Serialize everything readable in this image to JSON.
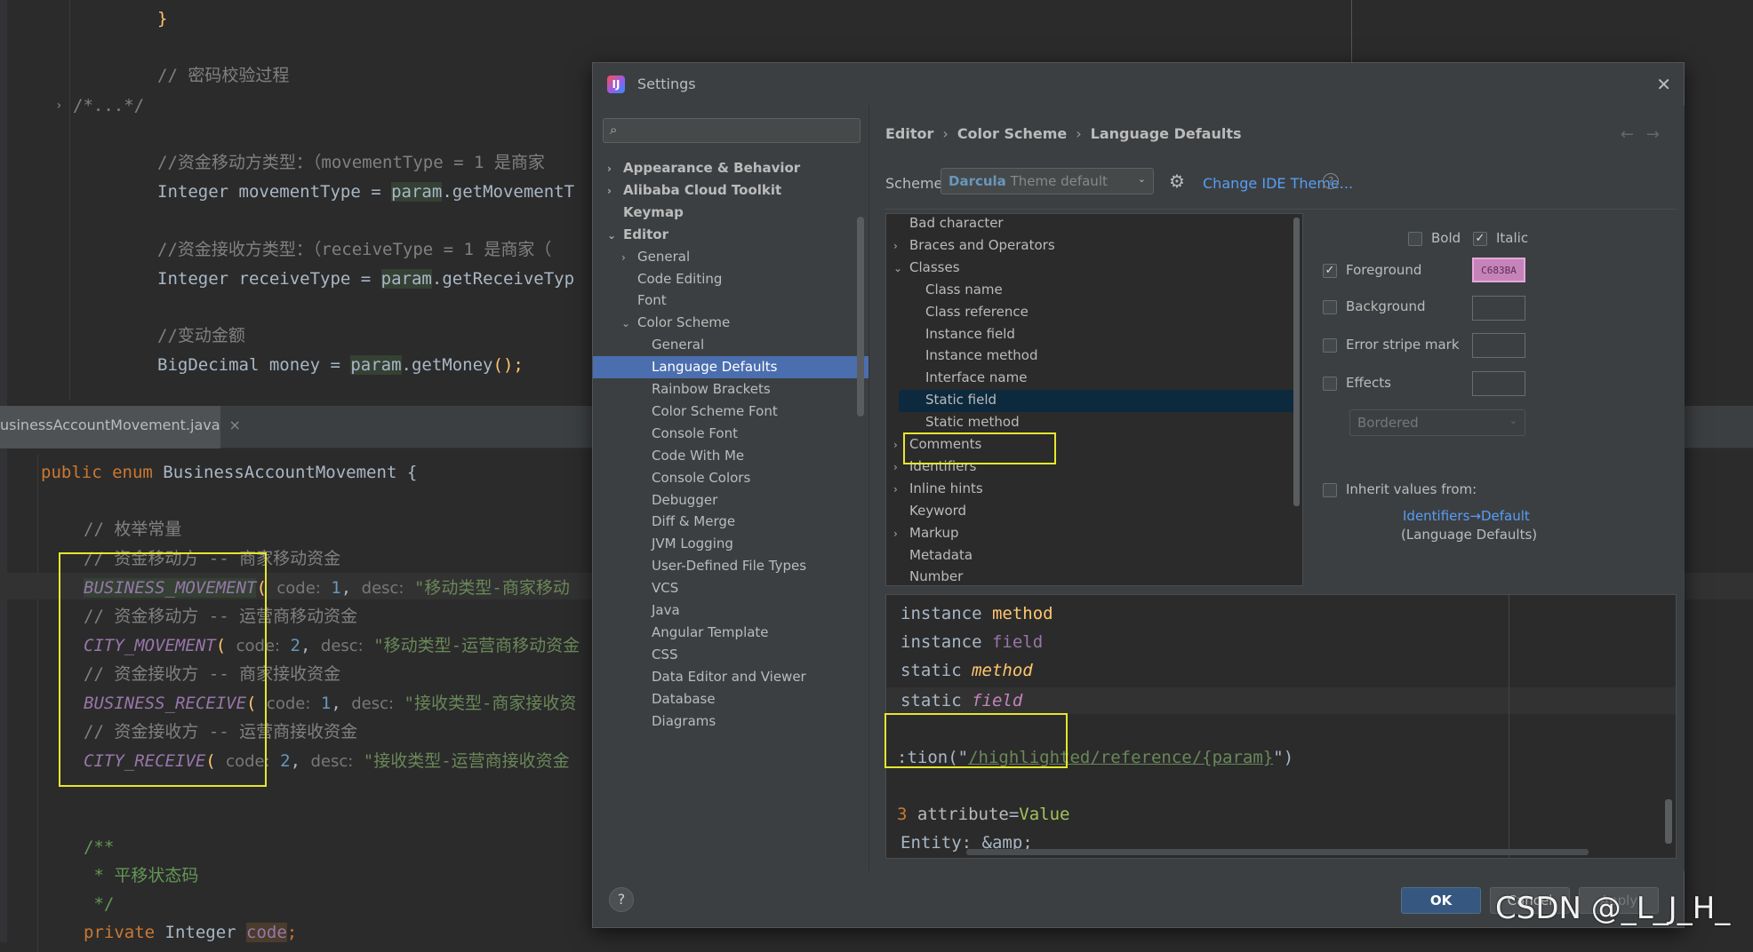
{
  "editor_top": {
    "line_brace": "}",
    "comment_verify": "// 密码校验过程",
    "folded": "/*...*/",
    "comment_movement_type": "//资金移动方类型：（movementType = 1 是商家",
    "movement_line_a": "Integer movementType = ",
    "movement_line_b": "param",
    "movement_line_c": ".getMovementT",
    "comment_receive_type": "//资金接收方类型：（receiveType = 1 是商家（",
    "receive_line_a": "Integer receiveType = ",
    "receive_line_b": "param",
    "receive_line_c": ".getReceiveTyp",
    "comment_amount": "//变动金额",
    "money_line_a": "BigDecimal money = ",
    "money_line_b": "param",
    "money_line_c": ".getMoney",
    "money_line_d": "();"
  },
  "tab": {
    "filename": "usinessAccountMovement.java",
    "close": "×"
  },
  "editor_bottom": {
    "enum_kw": "public enum ",
    "enum_name": "BusinessAccountMovement {",
    "comment_enum": "// 枚举常量",
    "c1": "// 资金移动方 -- 商家移动资金",
    "e1": "BUSINESS_MOVEMENT",
    "e1_rest_a": "code:",
    "e1_num": "1",
    "e1_rest_b": "desc:",
    "e1_str": "\"移动类型-商家移动",
    "c2": "// 资金移动方 -- 运营商移动资金",
    "e2": "CITY_MOVEMENT",
    "e2_num": "2",
    "e2_str": "\"移动类型-运营商移动资金",
    "c3": "// 资金接收方 -- 商家接收资金",
    "e3": "BUSINESS_RECEIVE",
    "e3_num": "1",
    "e3_str": "\"接收类型-商家接收资",
    "c4": "// 资金接收方 -- 运营商接收资金",
    "e4": "CITY_RECEIVE",
    "e4_num": "2",
    "e4_str": "\"接收类型-运营商接收资金",
    "doc1": "/**",
    "doc2": " * 平移状态码",
    "doc3": " */",
    "priv": "private ",
    "priv_type": "Integer ",
    "priv_field": "code",
    "priv_end": ";"
  },
  "dialog": {
    "title": "Settings",
    "logo": "IJ",
    "close": "✕",
    "search_icon": "⌕",
    "nav": [
      {
        "label": "Appearance & Behavior",
        "arrow": "›",
        "bold": true,
        "indent": 0
      },
      {
        "label": "Alibaba Cloud Toolkit",
        "arrow": "›",
        "bold": true,
        "indent": 0
      },
      {
        "label": "Keymap",
        "arrow": "",
        "bold": true,
        "indent": 0
      },
      {
        "label": "Editor",
        "arrow": "⌄",
        "bold": true,
        "indent": 0
      },
      {
        "label": "General",
        "arrow": "›",
        "bold": false,
        "indent": 1
      },
      {
        "label": "Code Editing",
        "arrow": "",
        "bold": false,
        "indent": 1
      },
      {
        "label": "Font",
        "arrow": "",
        "bold": false,
        "indent": 1
      },
      {
        "label": "Color Scheme",
        "arrow": "⌄",
        "bold": false,
        "indent": 1
      },
      {
        "label": "General",
        "arrow": "",
        "bold": false,
        "indent": 2
      },
      {
        "label": "Language Defaults",
        "arrow": "",
        "bold": false,
        "indent": 2
      },
      {
        "label": "Rainbow Brackets",
        "arrow": "",
        "bold": false,
        "indent": 2
      },
      {
        "label": "Color Scheme Font",
        "arrow": "",
        "bold": false,
        "indent": 2
      },
      {
        "label": "Console Font",
        "arrow": "",
        "bold": false,
        "indent": 2
      },
      {
        "label": "Code With Me",
        "arrow": "",
        "bold": false,
        "indent": 2
      },
      {
        "label": "Console Colors",
        "arrow": "",
        "bold": false,
        "indent": 2
      },
      {
        "label": "Debugger",
        "arrow": "",
        "bold": false,
        "indent": 2
      },
      {
        "label": "Diff & Merge",
        "arrow": "",
        "bold": false,
        "indent": 2
      },
      {
        "label": "JVM Logging",
        "arrow": "",
        "bold": false,
        "indent": 2
      },
      {
        "label": "User-Defined File Types",
        "arrow": "",
        "bold": false,
        "indent": 2
      },
      {
        "label": "VCS",
        "arrow": "",
        "bold": false,
        "indent": 2
      },
      {
        "label": "Java",
        "arrow": "",
        "bold": false,
        "indent": 2
      },
      {
        "label": "Angular Template",
        "arrow": "",
        "bold": false,
        "indent": 2
      },
      {
        "label": "CSS",
        "arrow": "",
        "bold": false,
        "indent": 2
      },
      {
        "label": "Data Editor and Viewer",
        "arrow": "",
        "bold": false,
        "indent": 2
      },
      {
        "label": "Database",
        "arrow": "",
        "bold": false,
        "indent": 2
      },
      {
        "label": "Diagrams",
        "arrow": "",
        "bold": false,
        "indent": 2
      }
    ],
    "selected_nav": "Language Defaults",
    "breadcrumb": [
      "Editor",
      "Color Scheme",
      "Language Defaults"
    ],
    "breadcrumb_sep": "›",
    "nav_back": "←",
    "nav_fwd": "→",
    "scheme_label": "Scheme:",
    "scheme_value": "Darcula",
    "scheme_suffix": " Theme default",
    "change_theme": "Change IDE Theme...",
    "help_q": "?",
    "tree": [
      {
        "label": "Bad character",
        "arrow": "",
        "indent": 0
      },
      {
        "label": "Braces and Operators",
        "arrow": "›",
        "indent": 0
      },
      {
        "label": "Classes",
        "arrow": "⌄",
        "indent": 0
      },
      {
        "label": "Class name",
        "arrow": "",
        "indent": 1
      },
      {
        "label": "Class reference",
        "arrow": "",
        "indent": 1
      },
      {
        "label": "Instance field",
        "arrow": "",
        "indent": 1
      },
      {
        "label": "Instance method",
        "arrow": "",
        "indent": 1
      },
      {
        "label": "Interface name",
        "arrow": "",
        "indent": 1
      },
      {
        "label": "Static field",
        "arrow": "",
        "indent": 1
      },
      {
        "label": "Static method",
        "arrow": "",
        "indent": 1
      },
      {
        "label": "Comments",
        "arrow": "›",
        "indent": 0
      },
      {
        "label": "Identifiers",
        "arrow": "›",
        "indent": 0
      },
      {
        "label": "Inline hints",
        "arrow": "›",
        "indent": 0
      },
      {
        "label": "Keyword",
        "arrow": "",
        "indent": 0
      },
      {
        "label": "Markup",
        "arrow": "›",
        "indent": 0
      },
      {
        "label": "Metadata",
        "arrow": "",
        "indent": 0
      },
      {
        "label": "Number",
        "arrow": "",
        "indent": 0
      }
    ],
    "selected_tree": "Static field",
    "options": {
      "bold": "Bold",
      "italic": "Italic",
      "foreground": "Foreground",
      "foreground_color": "C683BA",
      "background": "Background",
      "error_stripe": "Error stripe mark",
      "effects": "Effects",
      "effects_type": "Bordered",
      "inherit": "Inherit values from:",
      "inherit_link": "Identifiers→Default",
      "inherit_sub": "(Language Defaults)",
      "check": "✓"
    },
    "preview": {
      "l1a": "instance ",
      "l1b": "method",
      "l2a": "instance ",
      "l2b": "field",
      "l3a": "static ",
      "l3b": "method",
      "l4a": "static ",
      "l4b": "field",
      "l5a": ":tion(\"",
      "l5b": "/highlighted/reference/{param}",
      "l5c": "\")",
      "l6a": "3 ",
      "l6b": "attribute",
      "l6c": "=",
      "l6d": "Value",
      "l7": "Entity: &amp;"
    },
    "ok": "OK",
    "cancel": "Cancel",
    "apply": "Apply",
    "help": "?"
  },
  "watermark": "CSDN @_L_J_H_",
  "colors": {
    "accent": "#4b6eaf",
    "static_field": "#c683ba",
    "highlight_box": "#e6e62e"
  }
}
